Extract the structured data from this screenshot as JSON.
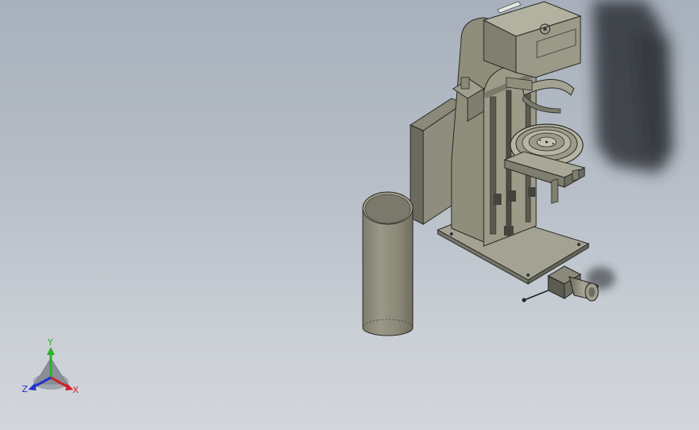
{
  "viewport": {
    "background_top": "#a7b0bc",
    "background_bottom": "#d3d6db"
  },
  "model": {
    "body_color": "#8f8e7b",
    "shadow_color": "#2e3238"
  },
  "triad": {
    "x_label": "X",
    "y_label": "Y",
    "z_label": "Z",
    "x_color": "#d0222a",
    "y_color": "#2db02d",
    "z_color": "#2233c8"
  }
}
